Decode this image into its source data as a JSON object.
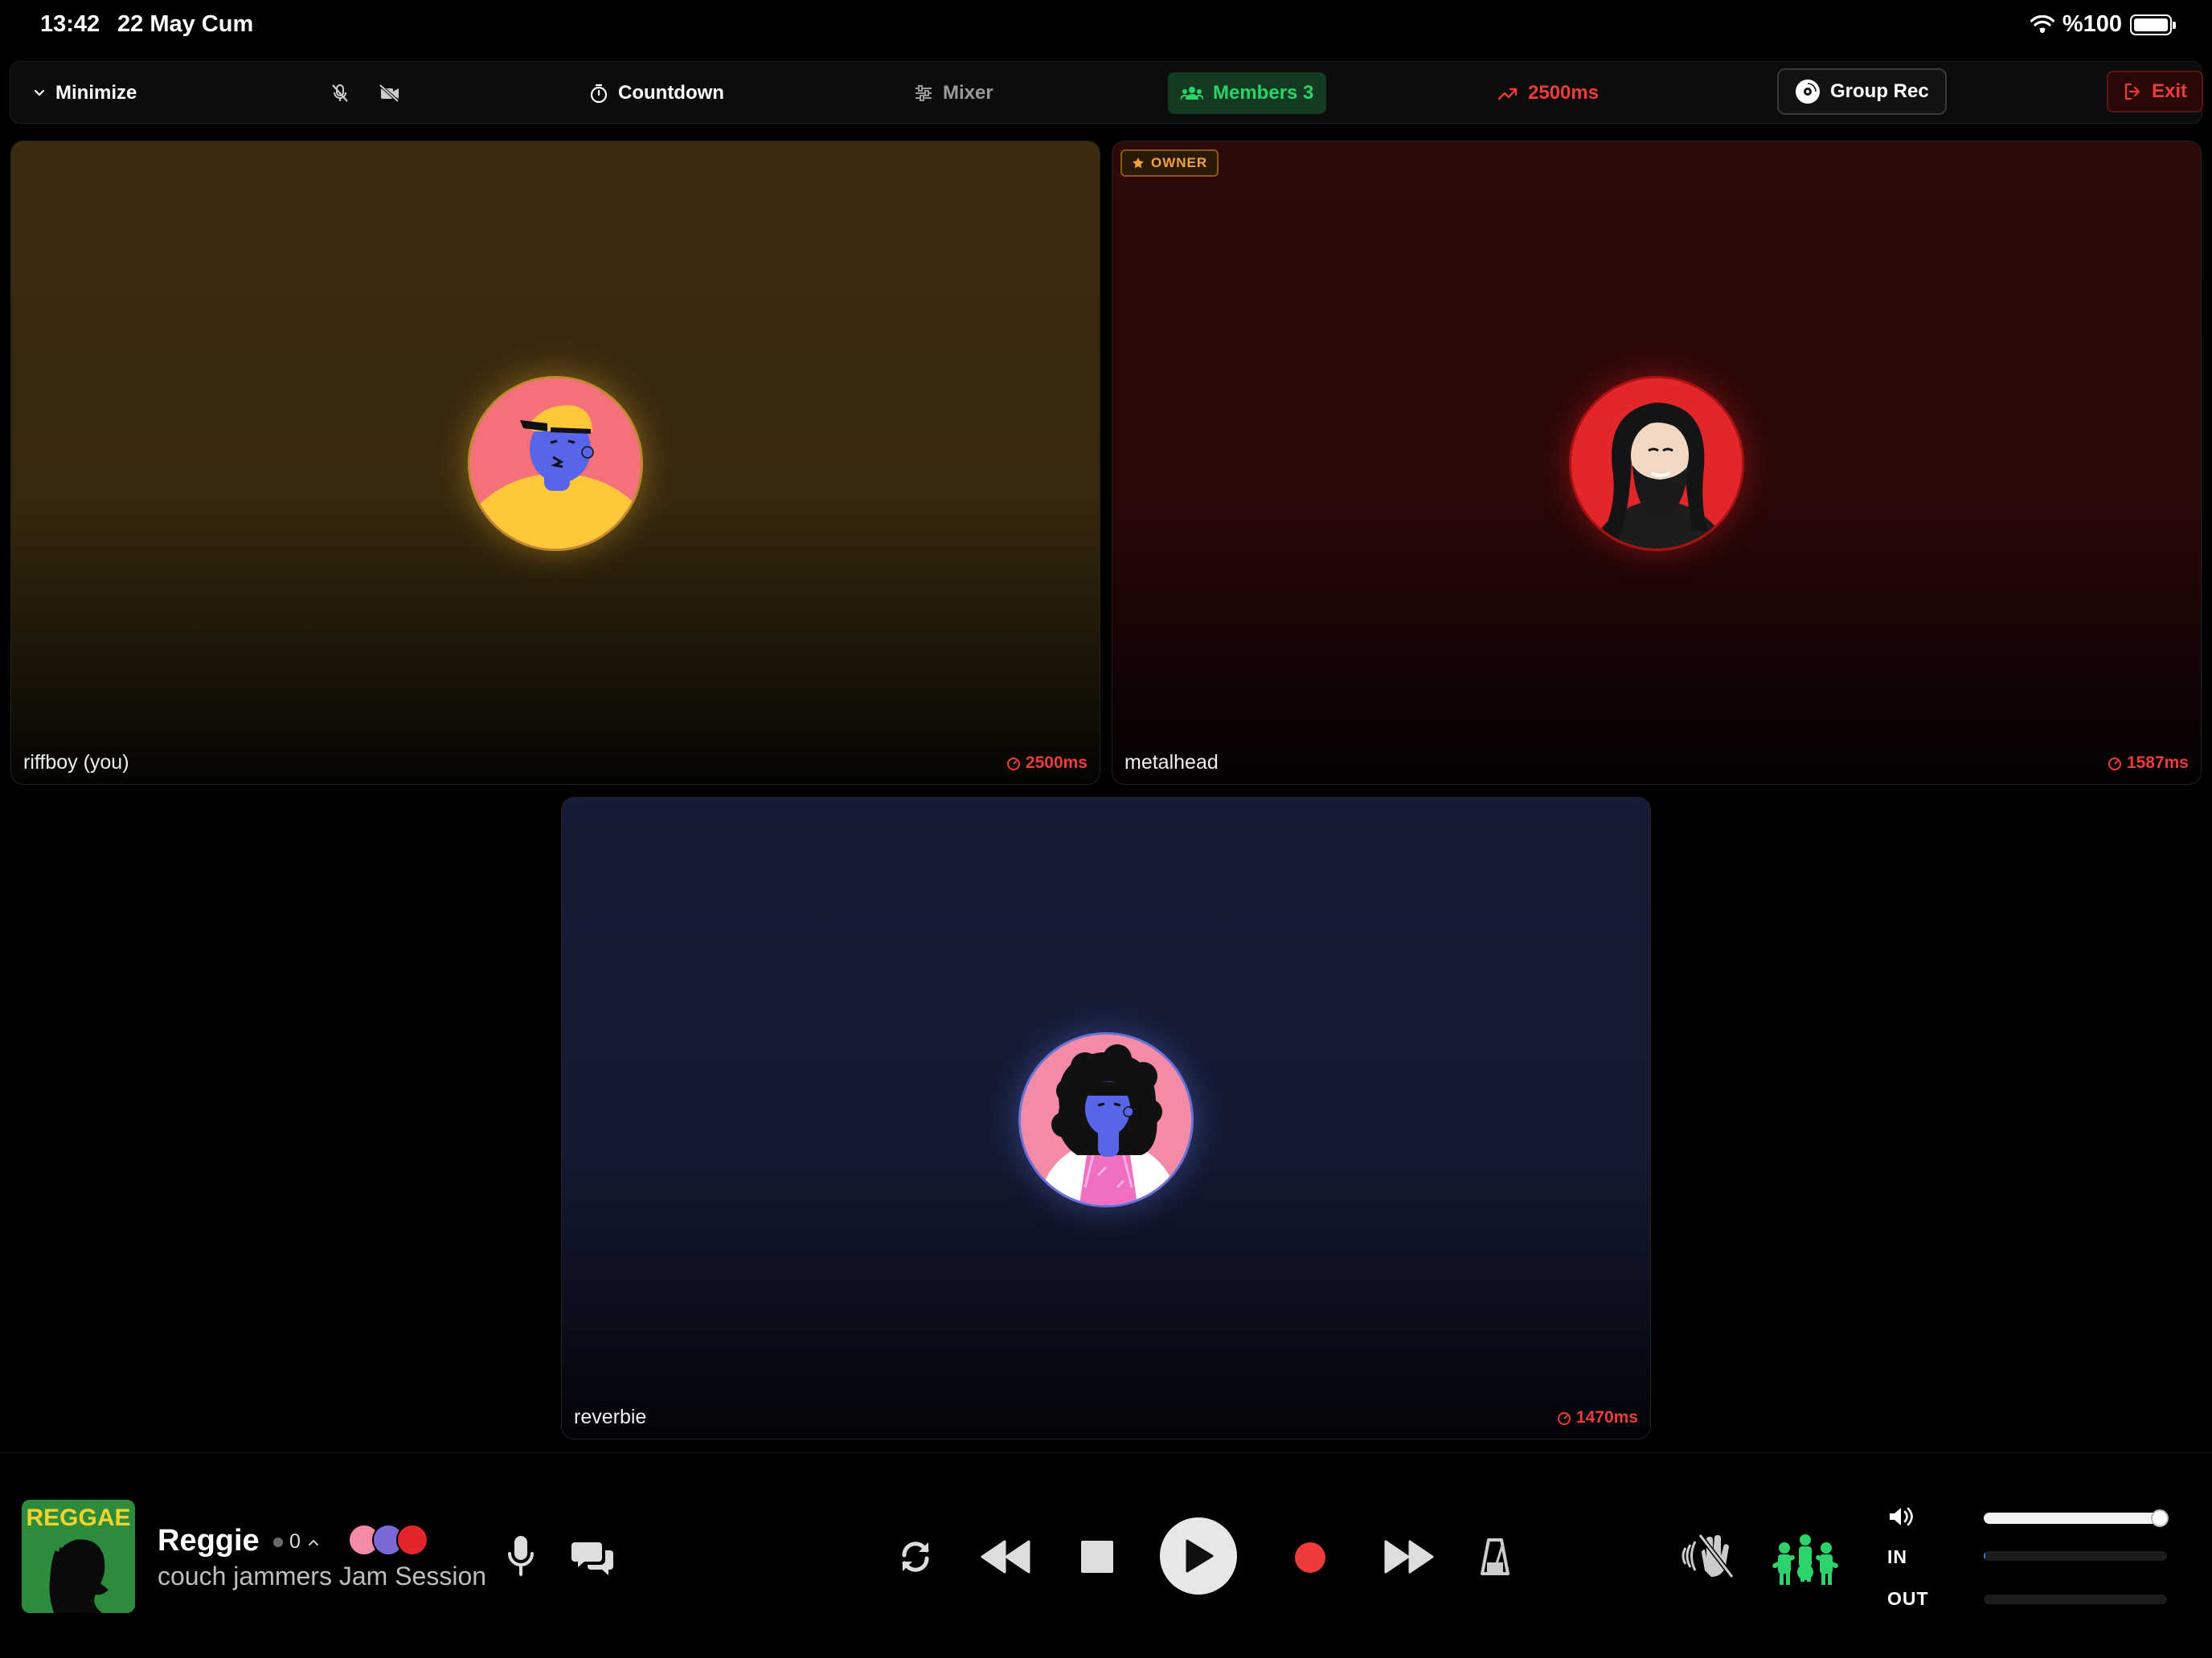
{
  "status_bar": {
    "time": "13:42",
    "date": "22 May Cum",
    "battery": "%100"
  },
  "toolbar": {
    "minimize_label": "Minimize",
    "countdown_label": "Countdown",
    "mixer_label": "Mixer",
    "members_label": "Members 3",
    "latency_label": "2500ms",
    "group_rec_label": "Group Rec",
    "exit_label": "Exit"
  },
  "tiles": [
    {
      "name": "riffboy (you)",
      "latency": "2500ms",
      "accent": "#3b2b0f"
    },
    {
      "name": "metalhead",
      "latency": "1587ms",
      "badge": "OWNER",
      "accent": "#2d0909"
    },
    {
      "name": "reverbie",
      "latency": "1470ms",
      "accent": "#161c35"
    }
  ],
  "player": {
    "album_label": "REGGAE",
    "title": "Reggie",
    "count": "0",
    "subtitle": "couch jammers Jam Session",
    "volume_level": 0.95,
    "in_label": "IN",
    "out_label": "OUT",
    "in_level": 0.01,
    "out_level": 0.0
  },
  "colors": {
    "accent_green": "#2bd46b",
    "accent_red": "#ef3b3b",
    "owner_orange": "#f0a43a"
  }
}
